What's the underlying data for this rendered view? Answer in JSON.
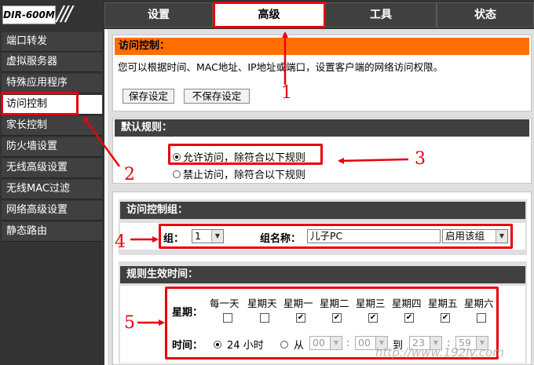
{
  "header": {
    "logo": "DIR-600M",
    "tabs": [
      {
        "label": "设置"
      },
      {
        "label": "高级"
      },
      {
        "label": "工具"
      },
      {
        "label": "状态"
      }
    ]
  },
  "sidebar": {
    "items": [
      {
        "label": "端口转发"
      },
      {
        "label": "虚拟服务器"
      },
      {
        "label": "特殊应用程序"
      },
      {
        "label": "访问控制"
      },
      {
        "label": "家长控制"
      },
      {
        "label": "防火墙设置"
      },
      {
        "label": "无线高级设置"
      },
      {
        "label": "无线MAC过滤"
      },
      {
        "label": "网络高级设置"
      },
      {
        "label": "静态路由"
      }
    ]
  },
  "access_control": {
    "title": "访问控制：",
    "description": "您可以根据时间、MAC地址、IP地址或端口，设置客户端的网络访问权限。",
    "save_label": "保存设定",
    "nosave_label": "不保存设定"
  },
  "default_rule": {
    "title": "默认规则：",
    "options": [
      "允许访问，除符合以下规则",
      "禁止访问，除符合以下规则"
    ],
    "selected": 0
  },
  "group": {
    "title": "访问控制组：",
    "group_label": "组：",
    "group_value": "1",
    "name_label": "组名称：",
    "name_value": "儿子PC",
    "enable_value": "启用该组"
  },
  "schedule": {
    "title": "规则生效时间：",
    "week_label": "星期：",
    "days": [
      "每一天",
      "星期天",
      "星期一",
      "星期二",
      "星期三",
      "星期四",
      "星期五",
      "星期六"
    ],
    "checked": [
      false,
      false,
      true,
      true,
      true,
      true,
      true,
      false
    ],
    "time_label": "时间：",
    "opt_24h": "24 小时",
    "opt_from": "从",
    "from_hour": "00",
    "from_min": "00",
    "to_label": "到",
    "to_hour": "23",
    "to_min": "59",
    "colon": ":"
  },
  "annotations": {
    "n1": "1",
    "n2": "2",
    "n3": "3",
    "n4": "4",
    "n5": "5",
    "color": "#e8000b"
  },
  "watermark": "http://www.192ly.com"
}
